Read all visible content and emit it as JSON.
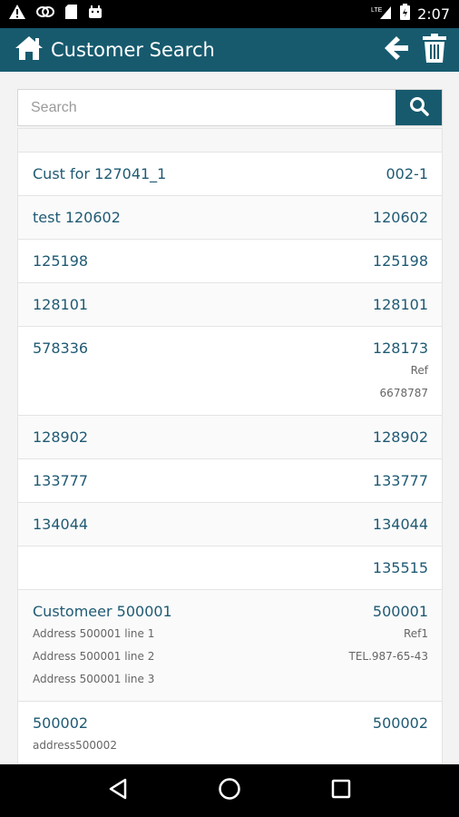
{
  "status_bar": {
    "time": "2:07",
    "network": "LTE"
  },
  "header": {
    "title": "Customer Search"
  },
  "search": {
    "placeholder": "Search",
    "value": ""
  },
  "customers": [
    {
      "name": "Cust for 127041_1",
      "code": "002-1",
      "address": [],
      "extra": []
    },
    {
      "name": "test 120602",
      "code": "120602",
      "address": [],
      "extra": []
    },
    {
      "name": "125198",
      "code": "125198",
      "address": [],
      "extra": []
    },
    {
      "name": "128101",
      "code": "128101",
      "address": [],
      "extra": []
    },
    {
      "name": "578336",
      "code": "128173",
      "address": [],
      "extra": [
        "Ref",
        "6678787"
      ]
    },
    {
      "name": "128902",
      "code": "128902",
      "address": [],
      "extra": []
    },
    {
      "name": "133777",
      "code": "133777",
      "address": [],
      "extra": []
    },
    {
      "name": "134044",
      "code": "134044",
      "address": [],
      "extra": []
    },
    {
      "name": "",
      "code": "135515",
      "address": [],
      "extra": []
    },
    {
      "name": "Customeer 500001",
      "code": "500001",
      "address": [
        "Address 500001 line 1",
        "Address 500001 line 2",
        "Address 500001 line 3"
      ],
      "extra": [
        "Ref1",
        "TEL.987-65-43"
      ]
    },
    {
      "name": "500002",
      "code": "500002",
      "address": [
        "address500002"
      ],
      "extra": []
    }
  ]
}
